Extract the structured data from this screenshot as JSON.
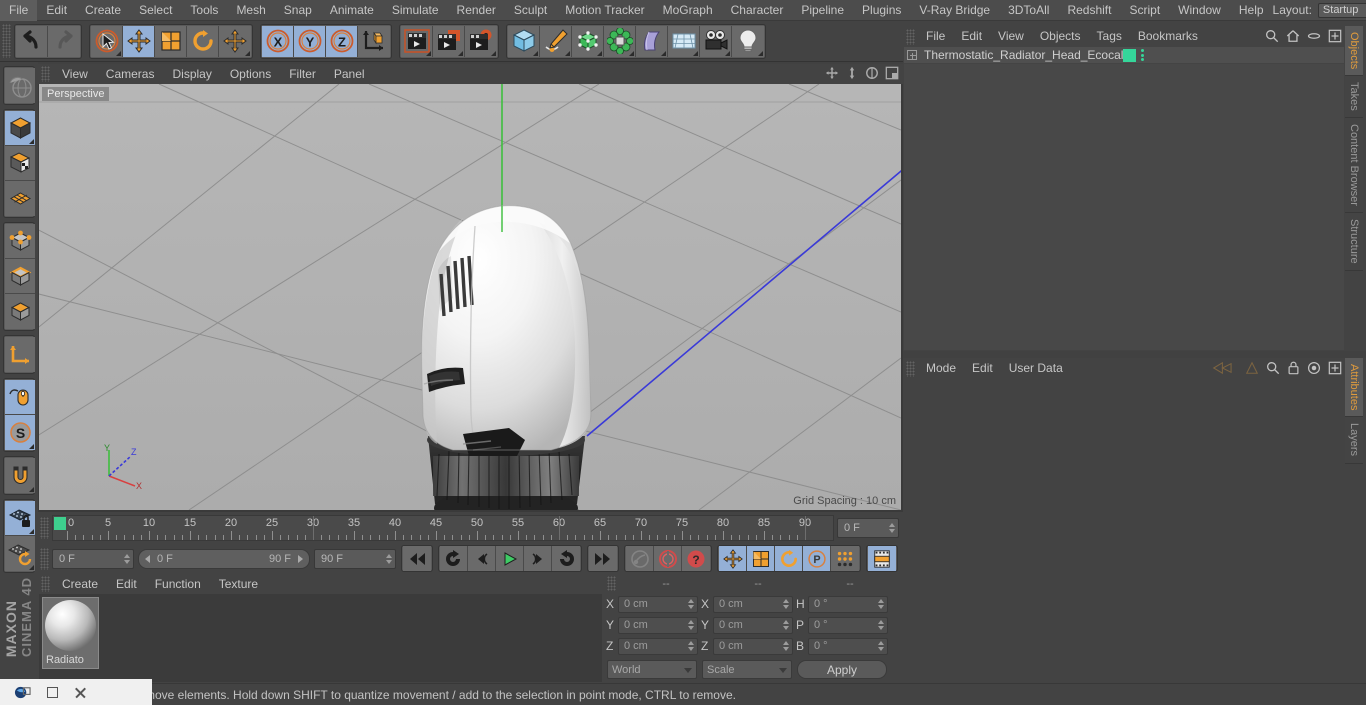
{
  "menubar": {
    "items": [
      "File",
      "Edit",
      "Create",
      "Select",
      "Tools",
      "Mesh",
      "Snap",
      "Animate",
      "Simulate",
      "Render",
      "Sculpt",
      "Motion Tracker",
      "MoGraph",
      "Character",
      "Pipeline",
      "Plugins",
      "V-Ray Bridge",
      "3DToAll",
      "Redshift",
      "Script",
      "Window",
      "Help"
    ],
    "layout_label": "Layout:",
    "layout_value": "Startup"
  },
  "toolbar": {
    "undo": "undo-arrow",
    "redo": "redo-arrow",
    "live_selection": "live-selection-tool",
    "move": "move-tool",
    "scale": "scale-tool",
    "rotate": "rotate-tool",
    "move_alt": "move-tool-alt",
    "axis_x": "X",
    "axis_y": "Y",
    "axis_z": "Z",
    "world_object_axis": "world-object-axis",
    "render_view": "render-view",
    "render_region": "render-region",
    "render_settings": "render-settings",
    "cube": "cube-primitive",
    "spline": "spline-pen",
    "array": "array-generator",
    "mograph": "mograph-cloner",
    "bend": "deformer-bend",
    "floor": "floor-environment",
    "camera": "camera-object",
    "light": "light-object"
  },
  "left_tools": {
    "items": [
      {
        "name": "undo-view-tool",
        "active": false
      },
      {
        "name": "model-mode",
        "active": true
      },
      {
        "name": "texture-mode",
        "active": false
      },
      {
        "name": "polygon-grid-mode",
        "active": false
      },
      {
        "name": "point-mode",
        "active": false
      },
      {
        "name": "edge-mode",
        "active": false
      },
      {
        "name": "polygon-mode",
        "active": false
      },
      {
        "name": "object-axis-mode",
        "active": false
      },
      {
        "name": "viewport-solo-mode",
        "active": true
      },
      {
        "name": "enable-axis-mode",
        "active": true
      },
      {
        "name": "magnet-tool",
        "active": false
      },
      {
        "name": "workplane-lock",
        "active": true
      },
      {
        "name": "workplane-rotate",
        "active": false
      }
    ],
    "brand_line1": "MAXON",
    "brand_line2": "CINEMA 4D"
  },
  "viewport": {
    "menu": [
      "View",
      "Cameras",
      "Display",
      "Options",
      "Filter",
      "Panel"
    ],
    "perspective_label": "Perspective",
    "grid_spacing": "Grid Spacing : 10 cm",
    "axis_labels": {
      "x": "X",
      "y": "Y",
      "z": "Z"
    },
    "nav_icons": [
      "pan-view-icon",
      "zoom-view-icon",
      "rotate-view-icon",
      "maximize-viewport-icon"
    ]
  },
  "timeline": {
    "ruler_labels": [
      "0",
      "5",
      "10",
      "15",
      "20",
      "25",
      "30",
      "35",
      "40",
      "45",
      "50",
      "55",
      "60",
      "65",
      "70",
      "75",
      "80",
      "85",
      "90"
    ],
    "ruler_min": 0,
    "ruler_max": 90,
    "current_frame_right": "0 F",
    "start_frame": "0 F",
    "range_start": "0 F",
    "range_end": "90 F",
    "end_frame": "90 F",
    "transport": [
      {
        "name": "go-to-start-button"
      },
      {
        "name": "previous-key-button"
      },
      {
        "name": "step-back-button"
      },
      {
        "name": "play-button"
      },
      {
        "name": "step-forward-button"
      },
      {
        "name": "next-key-button"
      },
      {
        "name": "go-to-end-button"
      }
    ],
    "record_controls": [
      {
        "name": "record-active-objects-button"
      },
      {
        "name": "autokeying-button"
      },
      {
        "name": "keyframe-selection-button"
      }
    ],
    "key_toggles": [
      {
        "name": "position-key-toggle",
        "active": true
      },
      {
        "name": "scale-key-toggle",
        "active": true
      },
      {
        "name": "rotation-key-toggle",
        "active": true
      },
      {
        "name": "parameter-key-toggle",
        "active": true
      },
      {
        "name": "point-level-animation-toggle",
        "active": false
      },
      {
        "name": "timeline-mode-button",
        "active": true
      }
    ]
  },
  "material_manager": {
    "menu": [
      "Create",
      "Edit",
      "Function",
      "Texture"
    ],
    "materials": [
      {
        "name": "Radiato"
      }
    ]
  },
  "coordinates": {
    "header_dashes": [
      "--",
      "--",
      "--"
    ],
    "rows": [
      {
        "label1": "X",
        "value1": "0 cm",
        "label2": "X",
        "value2": "0 cm",
        "label3": "H",
        "value3": "0 °"
      },
      {
        "label1": "Y",
        "value1": "0 cm",
        "label2": "Y",
        "value2": "0 cm",
        "label3": "P",
        "value3": "0 °"
      },
      {
        "label1": "Z",
        "value1": "0 cm",
        "label2": "Z",
        "value2": "0 cm",
        "label3": "B",
        "value3": "0 °"
      }
    ],
    "system": "World",
    "mode": "Scale",
    "apply": "Apply"
  },
  "object_manager": {
    "menu": [
      "File",
      "Edit",
      "View",
      "Objects",
      "Tags",
      "Bookmarks"
    ],
    "icons": [
      "search-icon",
      "home-icon",
      "ellipse-icon",
      "expand-icon"
    ],
    "objects": [
      {
        "name": "Thermostatic_Radiator_Head_Ecocal",
        "tag_color": "#35d69a"
      }
    ]
  },
  "attributes_manager": {
    "menu": [
      "Mode",
      "Edit",
      "User Data"
    ],
    "icons": [
      "back-nav-icon",
      "forward-nav-icon",
      "search-icon",
      "lock-icon",
      "target-icon",
      "expand-icon"
    ]
  },
  "right_tabs_top": [
    "Objects",
    "Takes",
    "Content Browser",
    "Structure"
  ],
  "right_tabs_bottom": [
    "Attributes",
    "Layers"
  ],
  "statusbar": {
    "message": "move elements. Hold down SHIFT to quantize movement / add to the selection in point mode, CTRL to remove."
  },
  "taskbar": {
    "items": [
      "c4d-app-icon",
      "restore-window-icon",
      "maximize-window-icon",
      "close-window-icon"
    ]
  },
  "colors": {
    "accent_orange": "#e09b3d",
    "selection_blue": "#94b0d6",
    "tag_green": "#35d69a",
    "panel_bg": "#434343",
    "viewport_bg": "#b3b3b3"
  }
}
